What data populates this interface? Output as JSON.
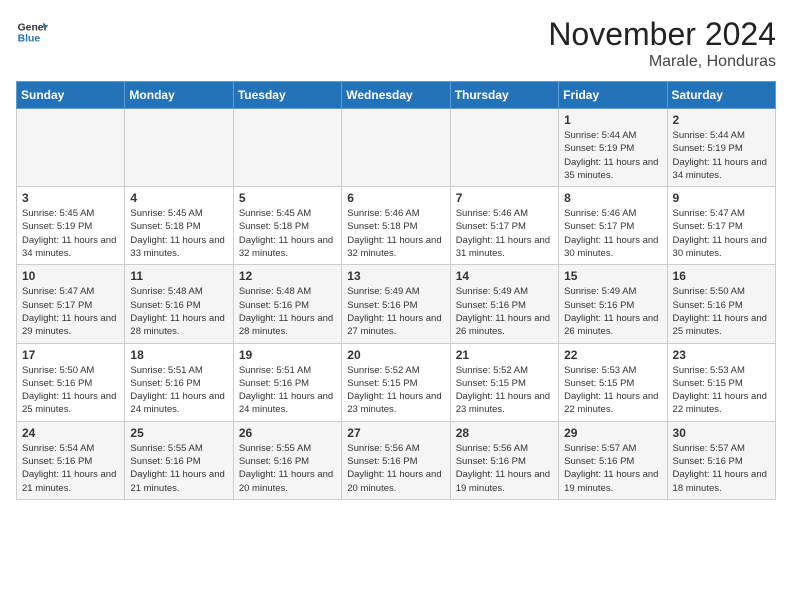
{
  "header": {
    "logo_line1": "General",
    "logo_line2": "Blue",
    "title": "November 2024",
    "subtitle": "Marale, Honduras"
  },
  "weekdays": [
    "Sunday",
    "Monday",
    "Tuesday",
    "Wednesday",
    "Thursday",
    "Friday",
    "Saturday"
  ],
  "weeks": [
    [
      {
        "day": "",
        "info": ""
      },
      {
        "day": "",
        "info": ""
      },
      {
        "day": "",
        "info": ""
      },
      {
        "day": "",
        "info": ""
      },
      {
        "day": "",
        "info": ""
      },
      {
        "day": "1",
        "info": "Sunrise: 5:44 AM\nSunset: 5:19 PM\nDaylight: 11 hours and 35 minutes."
      },
      {
        "day": "2",
        "info": "Sunrise: 5:44 AM\nSunset: 5:19 PM\nDaylight: 11 hours and 34 minutes."
      }
    ],
    [
      {
        "day": "3",
        "info": "Sunrise: 5:45 AM\nSunset: 5:19 PM\nDaylight: 11 hours and 34 minutes."
      },
      {
        "day": "4",
        "info": "Sunrise: 5:45 AM\nSunset: 5:18 PM\nDaylight: 11 hours and 33 minutes."
      },
      {
        "day": "5",
        "info": "Sunrise: 5:45 AM\nSunset: 5:18 PM\nDaylight: 11 hours and 32 minutes."
      },
      {
        "day": "6",
        "info": "Sunrise: 5:46 AM\nSunset: 5:18 PM\nDaylight: 11 hours and 32 minutes."
      },
      {
        "day": "7",
        "info": "Sunrise: 5:46 AM\nSunset: 5:17 PM\nDaylight: 11 hours and 31 minutes."
      },
      {
        "day": "8",
        "info": "Sunrise: 5:46 AM\nSunset: 5:17 PM\nDaylight: 11 hours and 30 minutes."
      },
      {
        "day": "9",
        "info": "Sunrise: 5:47 AM\nSunset: 5:17 PM\nDaylight: 11 hours and 30 minutes."
      }
    ],
    [
      {
        "day": "10",
        "info": "Sunrise: 5:47 AM\nSunset: 5:17 PM\nDaylight: 11 hours and 29 minutes."
      },
      {
        "day": "11",
        "info": "Sunrise: 5:48 AM\nSunset: 5:16 PM\nDaylight: 11 hours and 28 minutes."
      },
      {
        "day": "12",
        "info": "Sunrise: 5:48 AM\nSunset: 5:16 PM\nDaylight: 11 hours and 28 minutes."
      },
      {
        "day": "13",
        "info": "Sunrise: 5:49 AM\nSunset: 5:16 PM\nDaylight: 11 hours and 27 minutes."
      },
      {
        "day": "14",
        "info": "Sunrise: 5:49 AM\nSunset: 5:16 PM\nDaylight: 11 hours and 26 minutes."
      },
      {
        "day": "15",
        "info": "Sunrise: 5:49 AM\nSunset: 5:16 PM\nDaylight: 11 hours and 26 minutes."
      },
      {
        "day": "16",
        "info": "Sunrise: 5:50 AM\nSunset: 5:16 PM\nDaylight: 11 hours and 25 minutes."
      }
    ],
    [
      {
        "day": "17",
        "info": "Sunrise: 5:50 AM\nSunset: 5:16 PM\nDaylight: 11 hours and 25 minutes."
      },
      {
        "day": "18",
        "info": "Sunrise: 5:51 AM\nSunset: 5:16 PM\nDaylight: 11 hours and 24 minutes."
      },
      {
        "day": "19",
        "info": "Sunrise: 5:51 AM\nSunset: 5:16 PM\nDaylight: 11 hours and 24 minutes."
      },
      {
        "day": "20",
        "info": "Sunrise: 5:52 AM\nSunset: 5:15 PM\nDaylight: 11 hours and 23 minutes."
      },
      {
        "day": "21",
        "info": "Sunrise: 5:52 AM\nSunset: 5:15 PM\nDaylight: 11 hours and 23 minutes."
      },
      {
        "day": "22",
        "info": "Sunrise: 5:53 AM\nSunset: 5:15 PM\nDaylight: 11 hours and 22 minutes."
      },
      {
        "day": "23",
        "info": "Sunrise: 5:53 AM\nSunset: 5:15 PM\nDaylight: 11 hours and 22 minutes."
      }
    ],
    [
      {
        "day": "24",
        "info": "Sunrise: 5:54 AM\nSunset: 5:16 PM\nDaylight: 11 hours and 21 minutes."
      },
      {
        "day": "25",
        "info": "Sunrise: 5:55 AM\nSunset: 5:16 PM\nDaylight: 11 hours and 21 minutes."
      },
      {
        "day": "26",
        "info": "Sunrise: 5:55 AM\nSunset: 5:16 PM\nDaylight: 11 hours and 20 minutes."
      },
      {
        "day": "27",
        "info": "Sunrise: 5:56 AM\nSunset: 5:16 PM\nDaylight: 11 hours and 20 minutes."
      },
      {
        "day": "28",
        "info": "Sunrise: 5:56 AM\nSunset: 5:16 PM\nDaylight: 11 hours and 19 minutes."
      },
      {
        "day": "29",
        "info": "Sunrise: 5:57 AM\nSunset: 5:16 PM\nDaylight: 11 hours and 19 minutes."
      },
      {
        "day": "30",
        "info": "Sunrise: 5:57 AM\nSunset: 5:16 PM\nDaylight: 11 hours and 18 minutes."
      }
    ]
  ]
}
